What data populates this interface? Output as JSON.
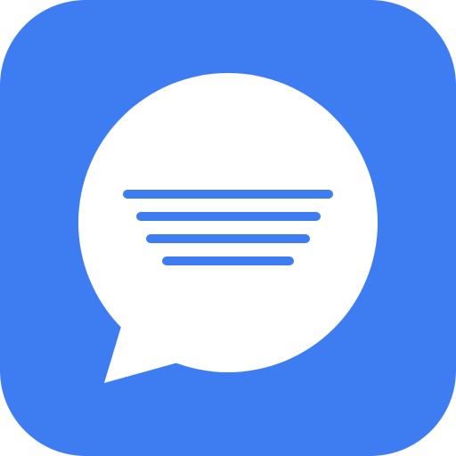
{
  "icon": {
    "name": "chat-bubble-icon",
    "background_color": "#3d7cf1",
    "bubble_color": "#ffffff",
    "line_color": "#3d7cf1"
  }
}
